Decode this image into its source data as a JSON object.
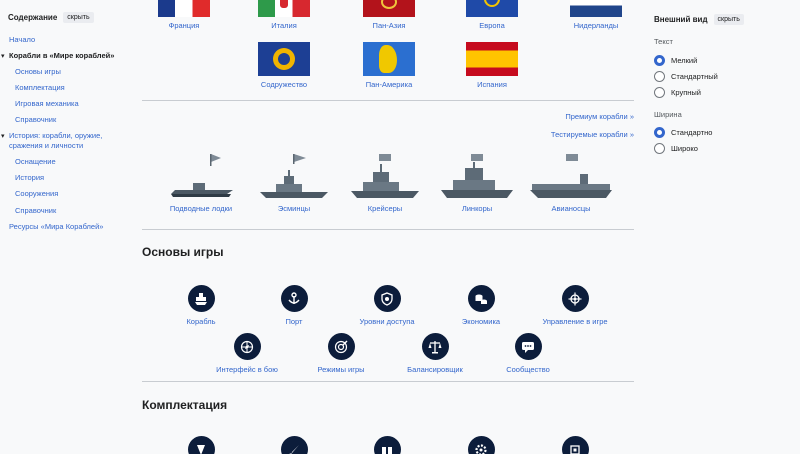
{
  "toc": {
    "title": "Содержание",
    "hide": "скрыть",
    "items": [
      "Начало",
      "Корабли в «Мире кораблей»",
      "Основы игры",
      "Комплектация",
      "Игровая механика",
      "Справочник",
      "История: корабли, оружие,",
      "сражения и личности",
      "Оснащение",
      "История",
      "Сооружения",
      "Справочник",
      "Ресурсы «Мира Кораблей»"
    ]
  },
  "appearance": {
    "title": "Внешний вид",
    "hide": "скрыть",
    "text_label": "Текст",
    "text_options": [
      "Мелкий",
      "Стандартный",
      "Крупный"
    ],
    "text_selected": 0,
    "width_label": "Ширина",
    "width_options": [
      "Стандартно",
      "Широко"
    ],
    "width_selected": 0
  },
  "nations_row1": [
    "Франция",
    "Италия",
    "Пан-Азия",
    "Европа",
    "Нидерланды"
  ],
  "nations_row2": [
    "Содружество",
    "Пан-Америка",
    "Испания"
  ],
  "links": {
    "premium": "Премиум корабли »",
    "test": "Тестируемые корабли »"
  },
  "ship_types": [
    "Подводные лодки",
    "Эсминцы",
    "Крейсеры",
    "Линкоры",
    "Авианосцы"
  ],
  "sections": {
    "basics": "Основы игры",
    "equipment": "Комплектация"
  },
  "basics_row1": [
    "Корабль",
    "Порт",
    "Уровни доступа",
    "Экономика",
    "Управление в игре"
  ],
  "basics_row2": [
    "Интерфейс в бою",
    "Режимы игры",
    "Балансировщик",
    "Сообщество"
  ],
  "icons": {
    "basics_row1": [
      "ship-icon",
      "anchor-icon",
      "shield-icon",
      "coins-icon",
      "helm-icon"
    ],
    "basics_row2": [
      "compass-icon",
      "target-icon",
      "scales-icon",
      "chat-icon"
    ],
    "equipment_row": [
      "module-icon",
      "rocket-icon",
      "container-icon",
      "gear-icon",
      "chip-icon"
    ]
  },
  "colors": {
    "accent": "#3366cc",
    "icon_bg": "#0c1d3b",
    "divider": "#c8ccd1"
  }
}
